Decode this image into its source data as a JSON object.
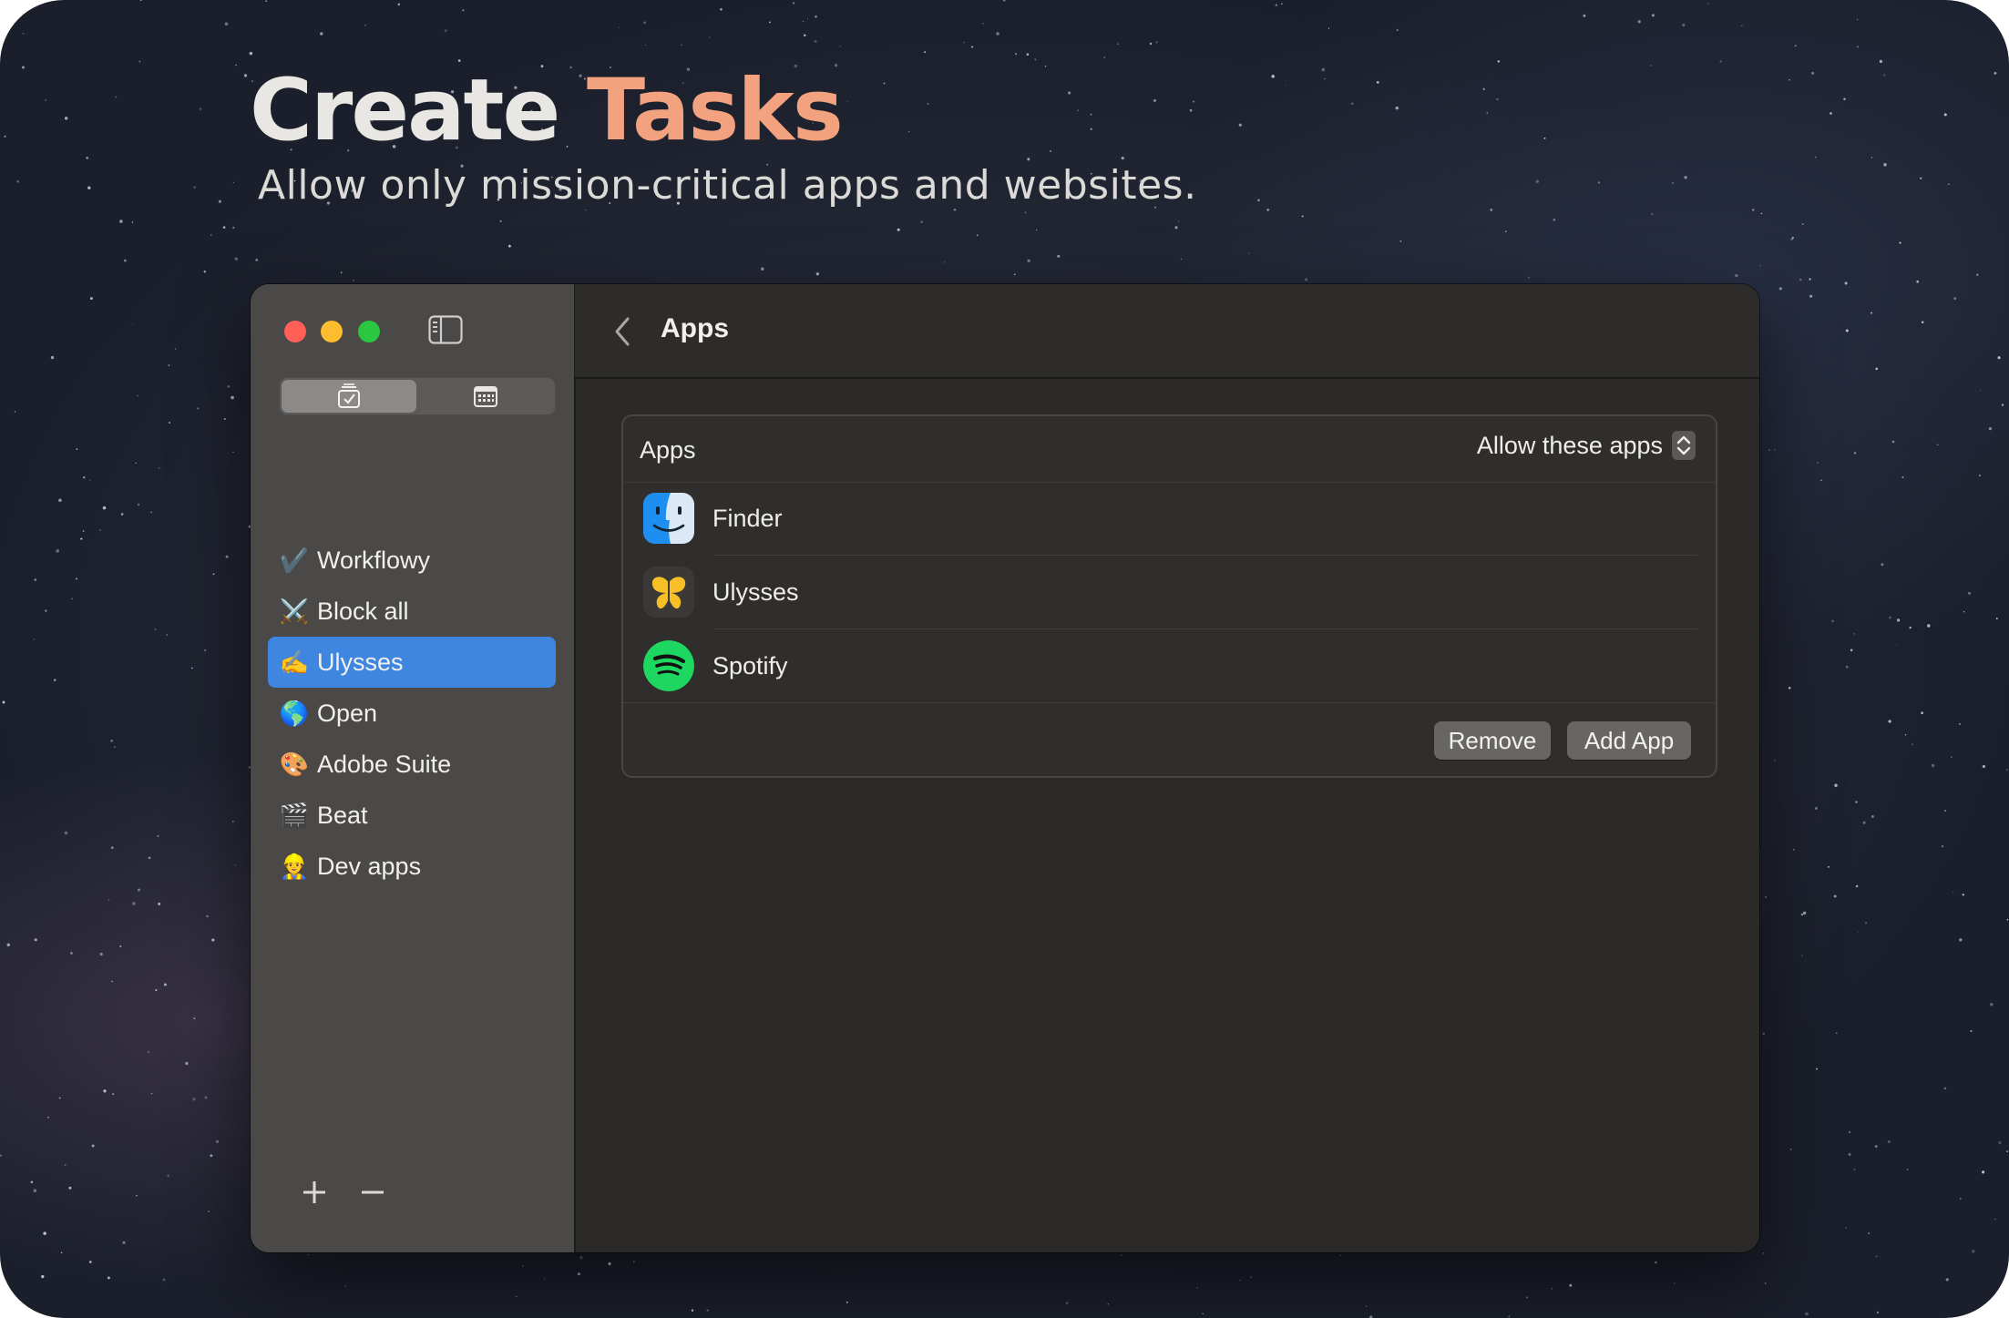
{
  "hero": {
    "title_plain": "Create",
    "title_accent": "Tasks",
    "subtitle": "Allow only mission-critical apps and websites."
  },
  "colors": {
    "accent": "#f3a27f",
    "selection": "#3f86e0",
    "traffic_close": "#fe5f57",
    "traffic_min": "#febc2e",
    "traffic_max": "#29c840"
  },
  "sidebar": {
    "segments": [
      {
        "icon": "tasks-checklist-icon",
        "selected": true
      },
      {
        "icon": "calendar-icon",
        "selected": false
      }
    ],
    "tasks": [
      {
        "label": "Workflowy",
        "emoji": "✔️",
        "icon": "checkbox-icon",
        "selected": false
      },
      {
        "label": "Block all",
        "emoji": "⚔️",
        "icon": "crossed-swords-icon",
        "selected": false
      },
      {
        "label": "Ulysses",
        "emoji": "✍️",
        "icon": "writing-hand-icon",
        "selected": true
      },
      {
        "label": "Open",
        "emoji": "🌎",
        "icon": "globe-icon",
        "selected": false
      },
      {
        "label": "Adobe Suite",
        "emoji": "🎨",
        "icon": "palette-icon",
        "selected": false
      },
      {
        "label": "Beat",
        "emoji": "🎬",
        "icon": "clapper-icon",
        "selected": false
      },
      {
        "label": "Dev apps",
        "emoji": "👷",
        "icon": "developer-icon",
        "selected": false
      }
    ],
    "add_symbol": "+",
    "remove_symbol": "−"
  },
  "main": {
    "title": "Apps",
    "panel": {
      "title": "Apps",
      "policy_label": "Allow these apps",
      "apps": [
        {
          "name": "Finder",
          "icon": "finder-icon"
        },
        {
          "name": "Ulysses",
          "icon": "ulysses-icon"
        },
        {
          "name": "Spotify",
          "icon": "spotify-icon"
        }
      ],
      "remove_label": "Remove",
      "add_label": "Add App"
    }
  }
}
